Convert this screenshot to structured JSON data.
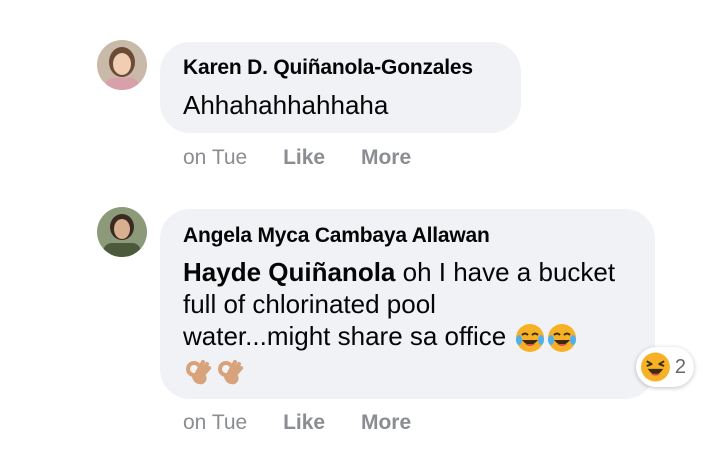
{
  "comments": [
    {
      "author": "Karen D. Quiñanola-Gonzales",
      "text": "Ahhahahhahhaha",
      "time": "on Tue",
      "like_label": "Like",
      "more_label": "More"
    },
    {
      "author": "Angela Myca Cambaya Allawan",
      "mention": "Hayde Quiñanola",
      "text_line1": " oh I have a bucket",
      "text_line2": "full of chlorinated pool",
      "text_line3": "water...might share sa office",
      "time": "on Tue",
      "like_label": "Like",
      "more_label": "More",
      "reaction_icon": "laughing-face-icon",
      "reaction_count": "2"
    }
  ],
  "colors": {
    "bubble": "#f0f2f5",
    "meta_text": "#8a8d91",
    "emoji_yellow": "#f7b125"
  }
}
